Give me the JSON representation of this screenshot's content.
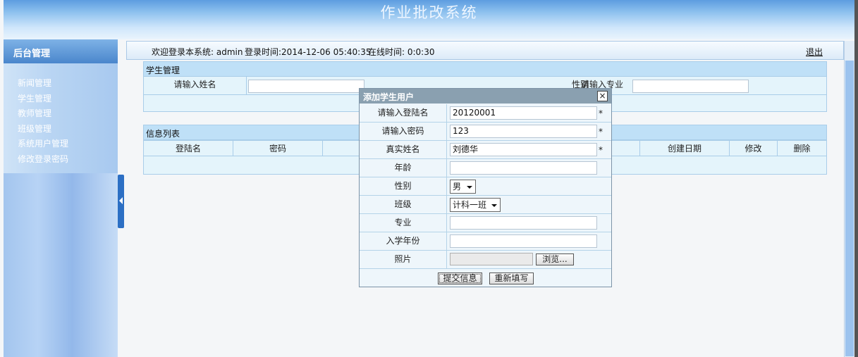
{
  "banner": {
    "title": "作业批改系统"
  },
  "sidebar": {
    "title": "后台管理",
    "items": [
      {
        "label": "新闻管理"
      },
      {
        "label": "学生管理"
      },
      {
        "label": "教师管理"
      },
      {
        "label": "班级管理"
      },
      {
        "label": "系统用户管理"
      },
      {
        "label": "修改登录密码"
      }
    ]
  },
  "infobar": {
    "welcome": "欢迎登录本系统: admin",
    "login_time": "登录时间:2014-12-06 05:40:35",
    "online_time": "在线时间: 0:0:30",
    "logout": "退出"
  },
  "search_panel": {
    "title": "学生管理",
    "name_label": "请输入姓名",
    "name_value": "",
    "gender_label": "性别",
    "major_label": "请输入专业",
    "major_value": ""
  },
  "list_panel": {
    "title": "信息列表",
    "columns": [
      "登陆名",
      "密码",
      "创建日期",
      "修改",
      "删除"
    ]
  },
  "modal": {
    "title": "添加学生用户",
    "close": "×",
    "login_label": "请输入登陆名",
    "login_value": "20120001",
    "password_label": "请输入密码",
    "password_value": "123",
    "realname_label": "真实姓名",
    "realname_value": "刘德华",
    "age_label": "年龄",
    "age_value": "",
    "gender_label": "性别",
    "gender_value": "男",
    "class_label": "班级",
    "class_value": "计科一班",
    "major_label": "专业",
    "major_value": "",
    "year_label": "入学年份",
    "year_value": "",
    "photo_label": "照片",
    "browse": "浏览...",
    "required_mark": "*",
    "submit": "提交信息",
    "reset": "重新填写"
  }
}
